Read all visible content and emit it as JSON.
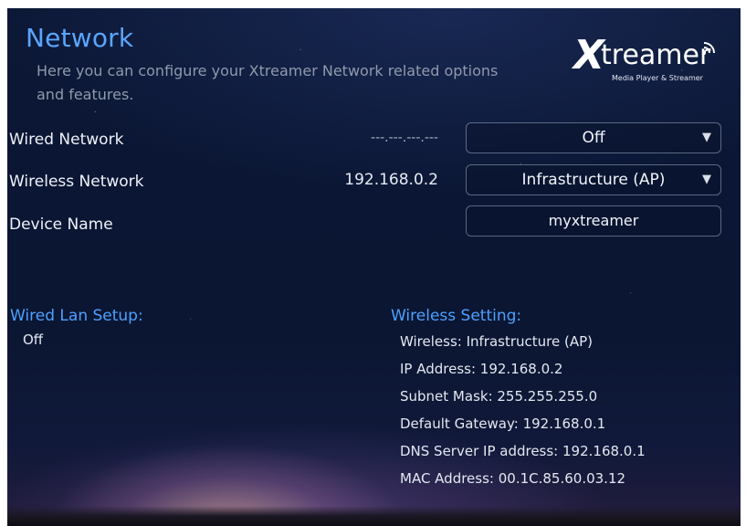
{
  "page": {
    "title": "Network",
    "subtitle": "Here you can configure your Xtreamer Network related options and features."
  },
  "logo": {
    "text_x": "X",
    "text_rest": "treamer",
    "tagline": "Media Player & Streamer"
  },
  "settings": {
    "wired": {
      "label": "Wired Network",
      "value": "---.---.---.---",
      "option": "Off"
    },
    "wireless": {
      "label": "Wireless Network",
      "value": "192.168.0.2",
      "option": "Infrastructure (AP)"
    },
    "device": {
      "label": "Device Name",
      "value": "myxtreamer"
    },
    "dropdown_arrow": "▼"
  },
  "wired_lan": {
    "title": "Wired Lan Setup:",
    "status": "Off"
  },
  "wireless_setting": {
    "title": "Wireless Setting:",
    "lines": [
      "Wireless: Infrastructure (AP)",
      "IP Address: 192.168.0.2",
      "Subnet Mask: 255.255.255.0",
      "Default Gateway: 192.168.0.1",
      "DNS Server IP address: 192.168.0.1",
      "MAC Address: 00.1C.85.60.03.12"
    ]
  },
  "colors": {
    "accent": "#5aa6ff",
    "background": "#0a1633",
    "text": "#eef2f8"
  }
}
